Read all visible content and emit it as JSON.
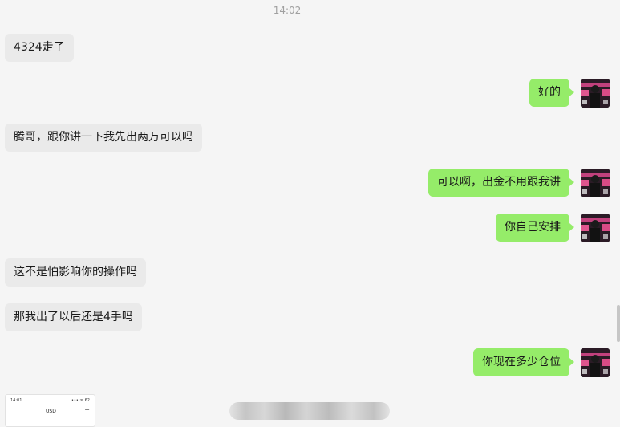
{
  "timestamp": "14:02",
  "messages": [
    {
      "side": "in",
      "text": "4324走了"
    },
    {
      "side": "out",
      "text": "好的"
    },
    {
      "side": "in",
      "text": "腾哥，跟你讲一下我先出两万可以吗"
    },
    {
      "side": "out",
      "text": "可以啊，出金不用跟我讲"
    },
    {
      "side": "out",
      "text": "你自己安排"
    },
    {
      "side": "in",
      "text": "这不是怕影响你的操作吗"
    },
    {
      "side": "in",
      "text": "那我出了以后还是4手吗"
    },
    {
      "side": "out",
      "text": "你现在多少仓位"
    }
  ],
  "preview": {
    "time": "14:01",
    "status": "••• ᯤ 62",
    "currency": "USD",
    "plus": "+"
  },
  "colors": {
    "background": "#f5f5f5",
    "incoming_bubble": "#eaeaea",
    "outgoing_bubble": "#95ec69"
  }
}
